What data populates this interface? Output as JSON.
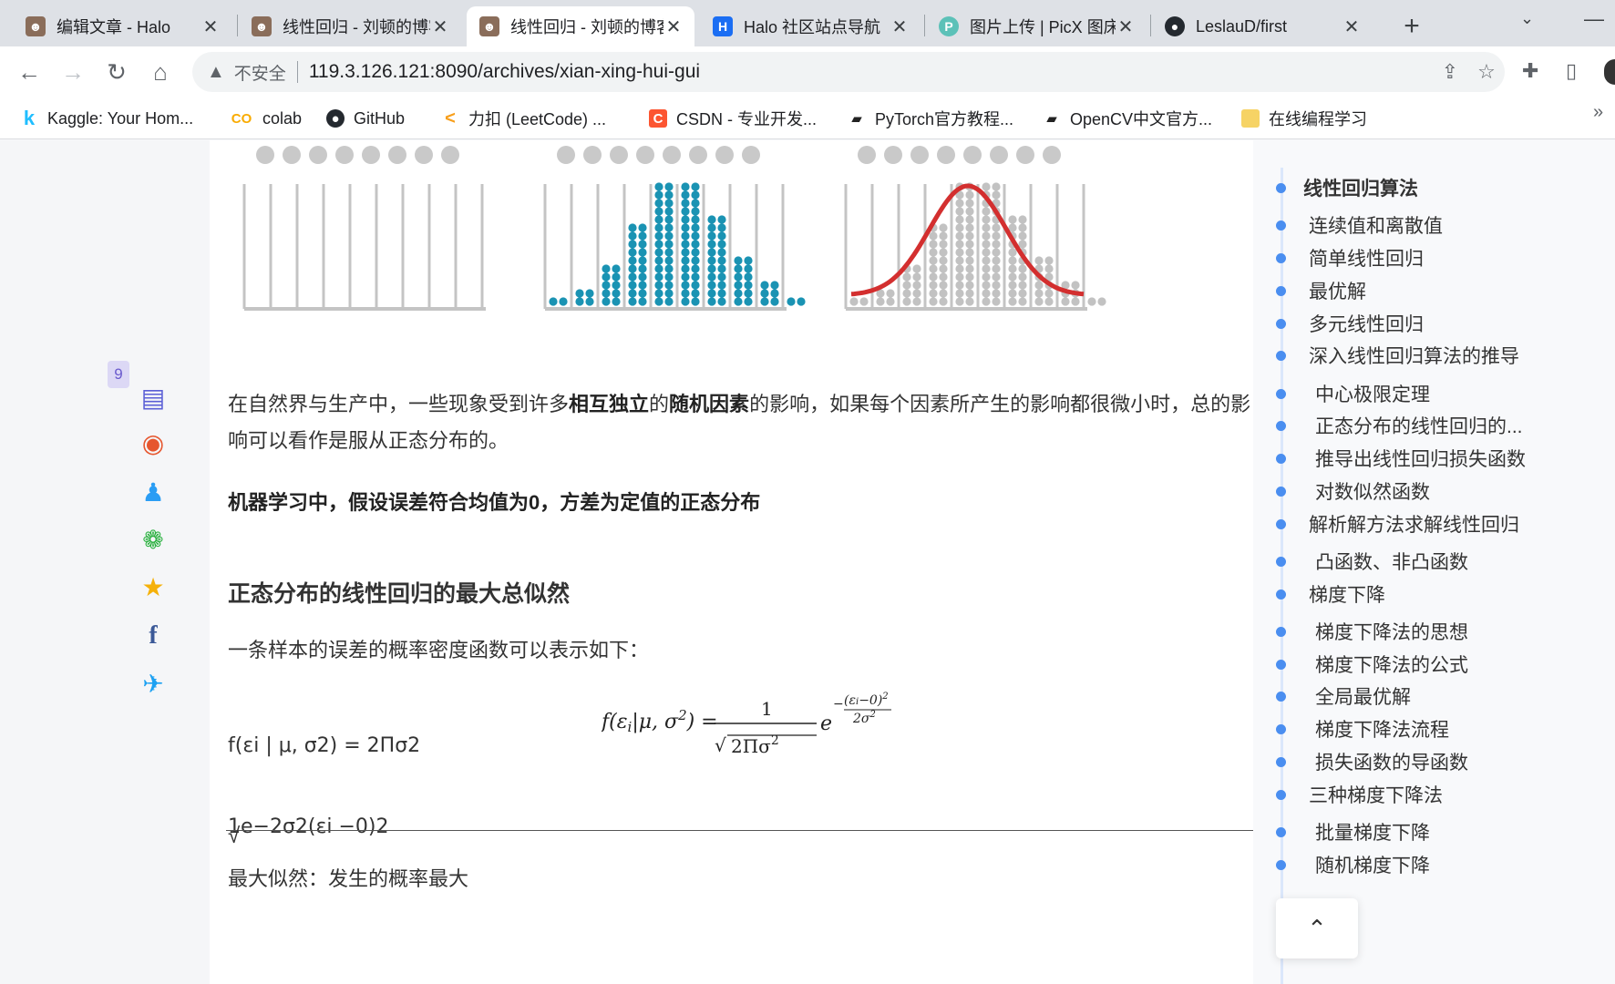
{
  "tabs": [
    {
      "title": "编辑文章 - Halo",
      "active": false
    },
    {
      "title": "线性回归 - 刘顿的博客",
      "active": false
    },
    {
      "title": "线性回归 - 刘顿的博客",
      "active": true
    },
    {
      "title": "Halo 社区站点导航",
      "active": false
    },
    {
      "title": "图片上传 | PicX 图床",
      "active": false
    },
    {
      "title": "LeslauD/first",
      "active": false
    }
  ],
  "toolbar": {
    "insecure_label": "不安全",
    "url": "119.3.126.121:8090/archives/xian-xing-hui-gui"
  },
  "bookmarks": [
    {
      "label": "Kaggle: Your Hom..."
    },
    {
      "label": "colab"
    },
    {
      "label": "GitHub"
    },
    {
      "label": "力扣 (LeetCode) ..."
    },
    {
      "label": "CSDN - 专业开发..."
    },
    {
      "label": "PyTorch官方教程..."
    },
    {
      "label": "OpenCV中文官方..."
    },
    {
      "label": "在线编程学习"
    }
  ],
  "share": {
    "count": "9"
  },
  "article": {
    "para1_a": "在自然界与生产中，一些现象受到许多",
    "para1_b": "相互独立",
    "para1_c": "的",
    "para1_d": "随机因素",
    "para1_e": "的影响，如果每个因素所产生的影响都很微小时，总的影响可以看作是服从正态分布的。",
    "para2": "机器学习中，假设误差符合均值为0，方差为定值的正态分布",
    "heading": "正态分布的线性回归的最大总似然",
    "para3": "一条样本的误差的概率密度函数可以表示如下：",
    "formula_text_1": "f(εi | μ, σ2) =    2Πσ2",
    "formula_text_2": "√",
    "formula_text_3": "1e−2σ2(εi −0)2",
    "para4": "最大似然：发生的概率最大"
  },
  "toc": [
    {
      "label": "线性回归算法",
      "level": 1
    },
    {
      "label": "连续值和离散值",
      "level": 2
    },
    {
      "label": "简单线性回归",
      "level": 2
    },
    {
      "label": "最优解",
      "level": 2
    },
    {
      "label": "多元线性回归",
      "level": 2
    },
    {
      "label": "深入线性回归算法的推导",
      "level": 2
    },
    {
      "label": "中心极限定理",
      "level": 3
    },
    {
      "label": "正态分布的线性回归的...",
      "level": 3
    },
    {
      "label": "推导出线性回归损失函数",
      "level": 3
    },
    {
      "label": "对数似然函数",
      "level": 3
    },
    {
      "label": "解析解方法求解线性回归",
      "level": 2
    },
    {
      "label": "凸函数、非凸函数",
      "level": 3
    },
    {
      "label": "梯度下降",
      "level": 2
    },
    {
      "label": "梯度下降法的思想",
      "level": 3
    },
    {
      "label": "梯度下降法的公式",
      "level": 3
    },
    {
      "label": "全局最优解",
      "level": 3
    },
    {
      "label": "梯度下降法流程",
      "level": 3
    },
    {
      "label": "损失函数的导函数",
      "level": 3
    },
    {
      "label": "三种梯度下降法",
      "level": 2
    },
    {
      "label": "批量梯度下降",
      "level": 3
    },
    {
      "label": "随机梯度下降",
      "level": 3
    }
  ]
}
